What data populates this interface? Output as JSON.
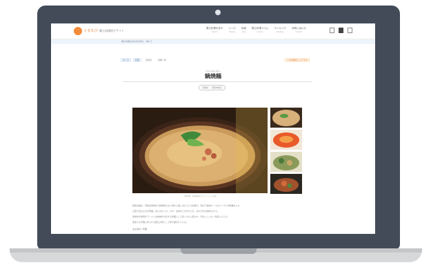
{
  "site": {
    "logo_text": "ぐるなび",
    "logo_sub": "郷土料理紹介サイト",
    "nav": [
      {
        "label": "郷土料理を探す",
        "sub": "Search"
      },
      {
        "label": "レシピ",
        "sub": "Recipe"
      },
      {
        "label": "地域",
        "sub": "Area"
      },
      {
        "label": "郷土料理コラム",
        "sub": "Column"
      },
      {
        "label": "ランキング",
        "sub": "Ranking"
      },
      {
        "label": "お問い合わせ",
        "sub": "Contact"
      }
    ],
    "subbar": "郷土料理の食文化を知る・味わう"
  },
  "page": {
    "breadcrumbs": [
      "ホーム",
      "四国",
      "高知県",
      "料理一覧"
    ],
    "share_label": "この料理をシェアする",
    "ruby": "ちゃんぽんめん",
    "title": "鍋焼麺",
    "tag": "高知県 ／ 高知市周辺",
    "photo_caption": "写真提供：高知県観光コンベンション協会",
    "body_lines": [
      "鍋焼き麺は、高知県須崎市で戦後間もない頃から親しまれている料理で、鶏ガラ醤油ベースのスープに中華麺を入れ、",
      "土鍋で煮込むのが特徴。具にはちくわ、ネギ、生卵などがのせられ、熱々のまま提供される。",
      "須崎市の鍋焼きラーメンは地域を代表する料理として多くの人に愛され、町おこしにも一役買っている。",
      "家庭でも手軽に作られる郷土の味として受け継がれている。"
    ],
    "bullet": "主な食材・料理"
  }
}
